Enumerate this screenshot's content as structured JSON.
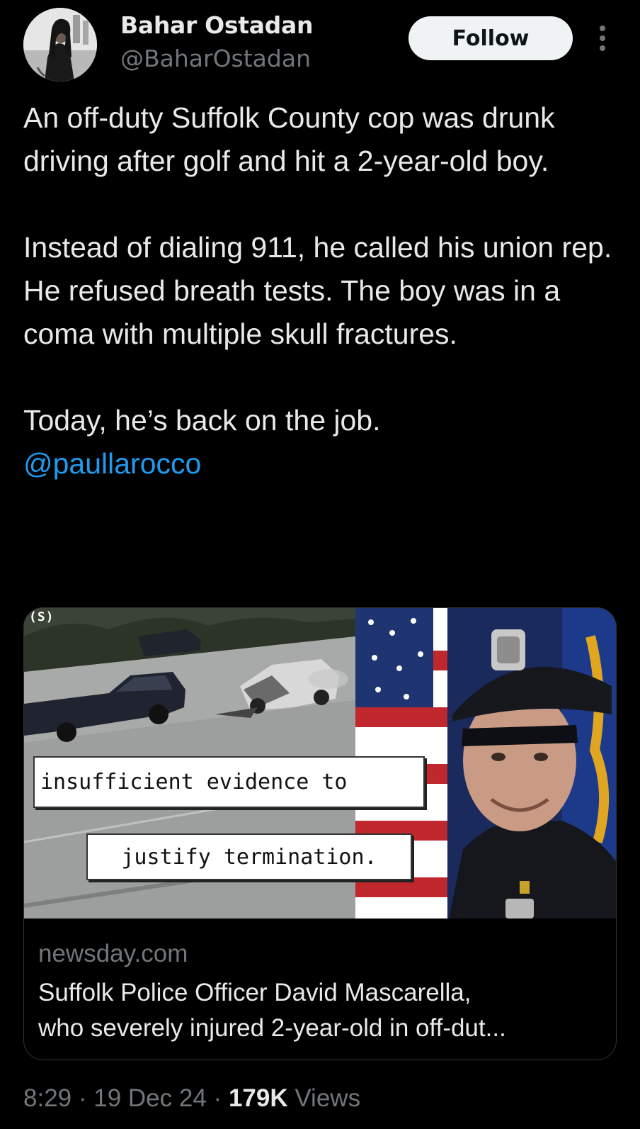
{
  "author": {
    "display_name": "Bahar Ostadan",
    "handle": "@BaharOstadan"
  },
  "actions": {
    "follow_label": "Follow",
    "more_icon": "more-vertical-icon"
  },
  "tweet": {
    "paragraph_1": "An off-duty Suffolk County cop was drunk driving after golf and hit a 2-year-old boy.",
    "paragraph_2": "Instead of dialing 911, he called his union rep. He refused breath tests. The boy was in a coma with multiple skull fractures.",
    "paragraph_3": "Today, he’s back on the job.",
    "mention": "@paullarocco"
  },
  "card": {
    "image": {
      "source_tag": "(S)",
      "caption_1": "insufficient evidence to",
      "caption_2": "justify termination."
    },
    "domain": "newsday.com",
    "title_line_1": "Suffolk Police Officer David Mascarella,",
    "title_line_2": "who severely injured 2-year-old in off-dut..."
  },
  "meta": {
    "time": "8:29",
    "separator": "·",
    "date": "19 Dec 24",
    "views_count": "179K",
    "views_label": "Views"
  },
  "colors": {
    "background": "#000000",
    "text": "#e7e9ea",
    "secondary": "#71767b",
    "link": "#1d9bf0",
    "follow_bg": "#eff3f4"
  }
}
